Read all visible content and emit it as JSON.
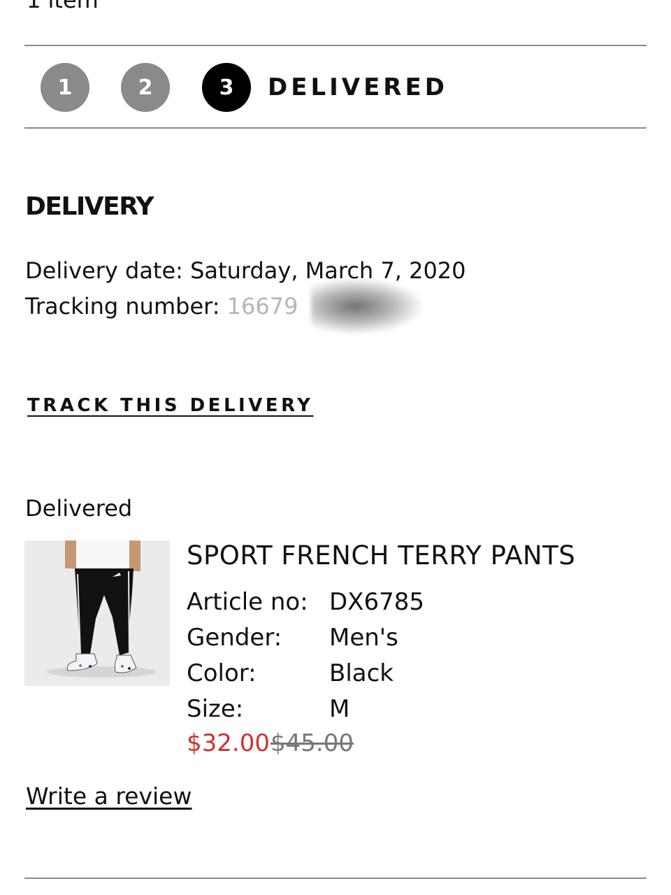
{
  "header": {
    "item_count_text": "1 item"
  },
  "steps": {
    "step1": "1",
    "step2": "2",
    "step3": "3",
    "current_label": "DELIVERED"
  },
  "delivery": {
    "heading": "DELIVERY",
    "date_label": "Delivery date:",
    "date_value": "Saturday, March 7, 2020",
    "tracking_label": "Tracking number:",
    "tracking_value_visible": "16679",
    "track_link": "TRACK THIS DELIVERY"
  },
  "item": {
    "status": "Delivered",
    "name": "SPORT FRENCH TERRY PANTS",
    "attributes": [
      {
        "label": "Article no:",
        "value": "DX6785"
      },
      {
        "label": "Gender:",
        "value": "Men's"
      },
      {
        "label": "Color:",
        "value": "Black"
      },
      {
        "label": "Size:",
        "value": "M"
      }
    ],
    "price_sale": "$32.00",
    "price_original": "$45.00",
    "review_link": "Write a review"
  },
  "colors": {
    "sale_price": "#d32f2f",
    "step_done": "#8a8a8a",
    "step_current": "#000000"
  }
}
